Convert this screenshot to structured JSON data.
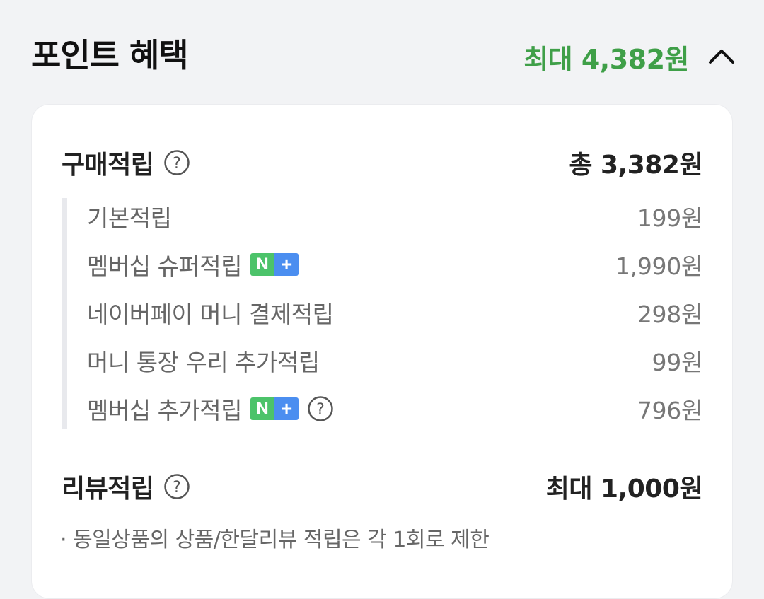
{
  "header": {
    "title": "포인트 혜택",
    "max_label": "최대 4,382원"
  },
  "purchase": {
    "title": "구매적립",
    "total": "총 3,382원",
    "items": [
      {
        "label": "기본적립",
        "value": "199원"
      },
      {
        "label": "멤버십 슈퍼적립",
        "value": "1,990원"
      },
      {
        "label": "네이버페이 머니 결제적립",
        "value": "298원"
      },
      {
        "label": "머니 통장 우리 추가적립",
        "value": "99원"
      },
      {
        "label": "멤버십 추가적립",
        "value": "796원"
      }
    ]
  },
  "review": {
    "title": "리뷰적립",
    "total": "최대 1,000원",
    "note": "· 동일상품의 상품/한달리뷰 적립은 각 1회로 제한"
  },
  "badge": {
    "n": "N",
    "plus": "+"
  },
  "colors": {
    "accent_green": "#3f9f48",
    "badge_green": "#4cc36a",
    "badge_blue": "#4b8ef0"
  },
  "icons": [
    "chevron-up-icon",
    "help-circle-icon",
    "naver-plus-badge-icon"
  ]
}
